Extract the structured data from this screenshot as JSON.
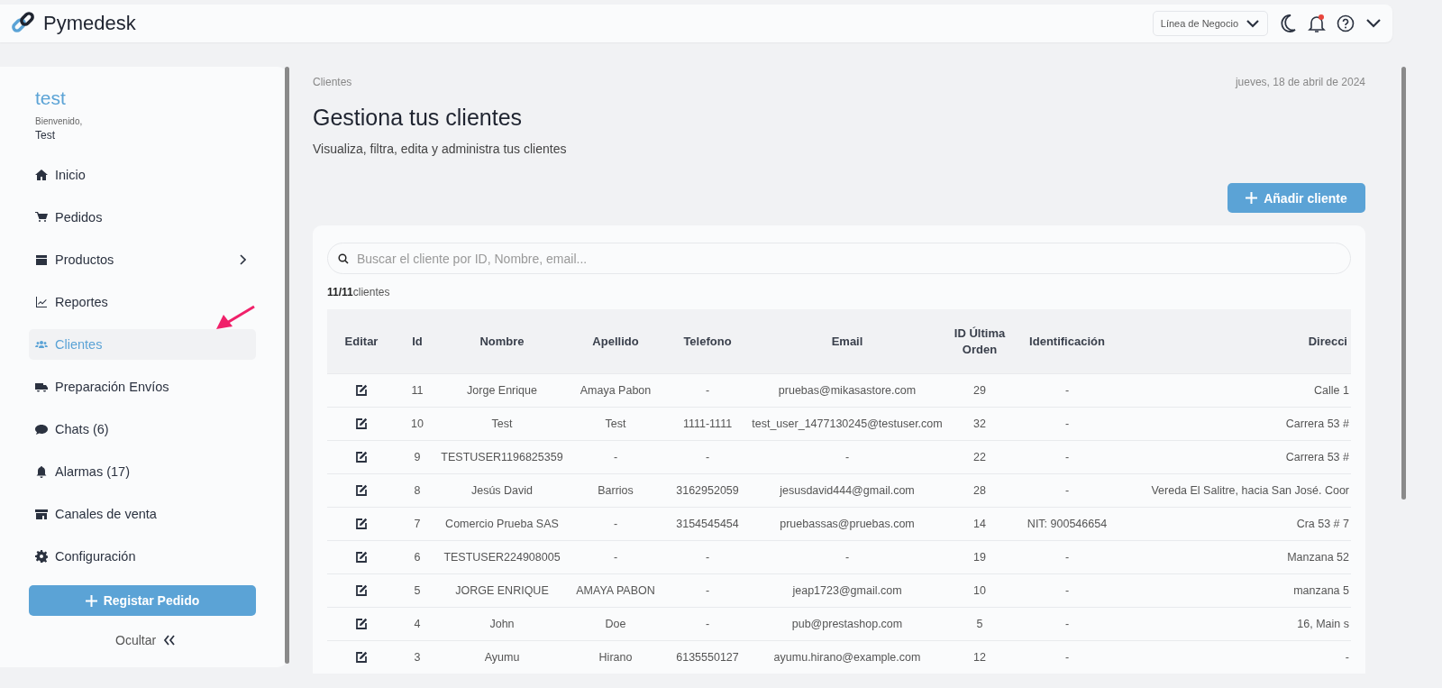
{
  "header": {
    "brand": "Pymedesk",
    "business_select": {
      "value": "Línea de Negocio"
    },
    "notifications": {
      "unread": true
    }
  },
  "sidebar": {
    "user": "test",
    "welcome": "Bienvenido,",
    "name": "Test",
    "items": [
      {
        "label": "Inicio",
        "selected": false,
        "expandable": false
      },
      {
        "label": "Pedidos",
        "selected": false,
        "expandable": false
      },
      {
        "label": "Productos",
        "selected": false,
        "expandable": true
      },
      {
        "label": "Reportes",
        "selected": false,
        "expandable": false
      },
      {
        "label": "Clientes",
        "selected": true,
        "expandable": false
      },
      {
        "label": "Preparación Envíos",
        "selected": false,
        "expandable": false
      },
      {
        "label": "Chats (6)",
        "selected": false,
        "expandable": false
      },
      {
        "label": "Alarmas (17)",
        "selected": false,
        "expandable": false
      },
      {
        "label": "Canales de venta",
        "selected": false,
        "expandable": false
      },
      {
        "label": "Configuración",
        "selected": false,
        "expandable": false
      }
    ],
    "primary_button": "Registar Pedido",
    "hide_link": "Ocultar"
  },
  "page": {
    "breadcrumb": "Clientes",
    "date": "jueves, 18 de abril de 2024",
    "title": "Gestiona tus clientes",
    "subtitle": "Visualiza, filtra, edita y administra tus clientes",
    "add_button": "Añadir cliente",
    "search": {
      "placeholder": "Buscar el cliente por ID, Nombre, email..."
    },
    "count": "**11/11**clientes"
  },
  "table": {
    "columns": [
      "Editar",
      "Id",
      "Nombre",
      "Apellido",
      "Telefono",
      "Email",
      "ID Última Orden",
      "Identificación",
      "Direcci"
    ],
    "rows": [
      [
        "",
        "11",
        "Jorge Enrique",
        "Amaya Pabon",
        "-",
        "pruebas@mikasastore.com",
        "29",
        "-",
        "Calle 1"
      ],
      [
        "",
        "10",
        "Test",
        "Test",
        "1111-1111",
        "test_user_1477130245@testuser.com",
        "32",
        "-",
        "Carrera 53 #"
      ],
      [
        "",
        "9",
        "TESTUSER1196825359",
        "-",
        "-",
        "-",
        "22",
        "-",
        "Carrera 53 #"
      ],
      [
        "",
        "8",
        "Jesús David",
        "Barrios",
        "3162952059",
        "jesusdavid444@gmail.com",
        "28",
        "-",
        "Vereda El Salitre, hacia San José. Coor"
      ],
      [
        "",
        "7",
        "Comercio Prueba SAS",
        "-",
        "3154545454",
        "pruebassas@pruebas.com",
        "14",
        "NIT: 900546654",
        "Cra 53 # 7"
      ],
      [
        "",
        "6",
        "TESTUSER224908005",
        "-",
        "-",
        "-",
        "19",
        "-",
        "Manzana 52"
      ],
      [
        "",
        "5",
        "JORGE ENRIQUE",
        "AMAYA PABON",
        "-",
        "jeap1723@gmail.com",
        "10",
        "-",
        "manzana 5"
      ],
      [
        "",
        "4",
        "John",
        "Doe",
        "-",
        "pub@prestashop.com",
        "5",
        "-",
        "16, Main s"
      ],
      [
        "",
        "3",
        "Ayumu",
        "Hirano",
        "6135550127",
        "ayumu.hirano@example.com",
        "12",
        "-",
        "-"
      ]
    ]
  }
}
